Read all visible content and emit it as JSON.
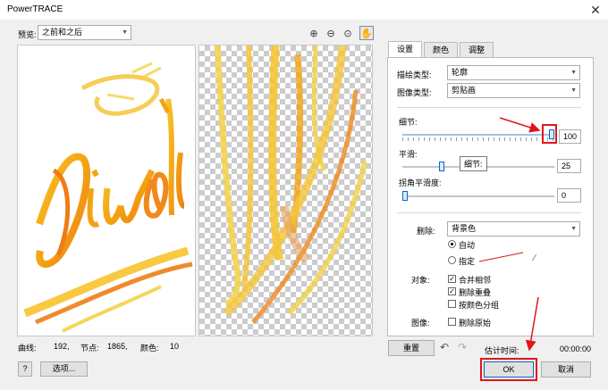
{
  "window": {
    "title": "PowerTRACE",
    "close_glyph": "✕"
  },
  "preview": {
    "label": "预览:",
    "mode_value": "之前和之后",
    "zoom_tools": [
      "zoom-in-icon",
      "zoom-out-icon",
      "zoom-fit-icon",
      "pan-hand-icon"
    ]
  },
  "image": {
    "word": "Diwali",
    "palette": [
      "#f4a312",
      "#f7c32c",
      "#f08a1c",
      "#f3d24a"
    ]
  },
  "stats": {
    "curves_label": "曲线:",
    "curves_value": "192,",
    "nodes_label": "节点:",
    "nodes_value": "1865,",
    "colors_label": "颜色:",
    "colors_value": "10"
  },
  "tabs": [
    "设置",
    "颜色",
    "调整"
  ],
  "settings": {
    "trace_type_label": "描绘类型:",
    "trace_type_value": "轮廓",
    "image_type_label": "图像类型:",
    "image_type_value": "剪贴画",
    "detail_label": "细节:",
    "detail_value": "100",
    "smoothing_label": "平滑:",
    "smoothing_value": "25",
    "corner_label": "拐角平滑度:",
    "corner_value": "0",
    "tooltip_text": "细节:",
    "delete_label": "删除:",
    "delete_value": "背景色",
    "auto_label": "自动",
    "specify_label": "指定",
    "options_label": "对象:",
    "merge_label": "合并相邻",
    "merge_checked": true,
    "remove_overlap_label": "删除重叠",
    "remove_overlap_checked": true,
    "group_label": "按颜色分组",
    "group_checked": false,
    "image_label": "图像:",
    "delete_original_label": "删除原始",
    "delete_original_checked": false
  },
  "sliders": {
    "detail": 1.0,
    "smoothing": 0.25,
    "corner": 0.0
  },
  "footer": {
    "reset_label": "重置",
    "time_label": "估计时间:",
    "time_value": "00:00:00",
    "help_label": "?",
    "options_label": "选项...",
    "ok_label": "OK",
    "cancel_label": "取消"
  },
  "colors": {
    "annotation_red": "#e0161a",
    "slider_accent": "#0a64c8"
  }
}
